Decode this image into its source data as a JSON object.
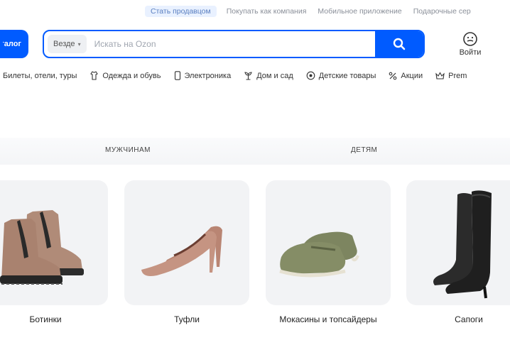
{
  "top_links": [
    "Стать продавцом",
    "Покупать как компания",
    "Мобильное приложение",
    "Подарочные сер"
  ],
  "header": {
    "catalog_label": "Каталог",
    "search": {
      "scope": "Везде",
      "placeholder": "Искать на Ozon"
    },
    "login_label": "Войти"
  },
  "categories": [
    {
      "label": "Билеты, отели, туры",
      "icon": "ticket-icon"
    },
    {
      "label": "Одежда и обувь",
      "icon": "clothes-icon"
    },
    {
      "label": "Электроника",
      "icon": "phone-icon"
    },
    {
      "label": "Дом и сад",
      "icon": "plant-icon"
    },
    {
      "label": "Детские товары",
      "icon": "kids-icon"
    },
    {
      "label": "Акции",
      "icon": "percent-icon"
    },
    {
      "label": "Prem",
      "icon": "crown-icon"
    }
  ],
  "audience_tabs": [
    "Мужчинам",
    "Детям"
  ],
  "products": [
    {
      "label": "Ботинки",
      "icon": "boots-icon"
    },
    {
      "label": "Туфли",
      "icon": "heels-icon"
    },
    {
      "label": "Мокасины и топсайдеры",
      "icon": "loafers-icon"
    },
    {
      "label": "Сапоги",
      "icon": "tall-boots-icon"
    }
  ],
  "colors": {
    "accent": "#005bff",
    "tile_bg": "#f2f3f5"
  }
}
